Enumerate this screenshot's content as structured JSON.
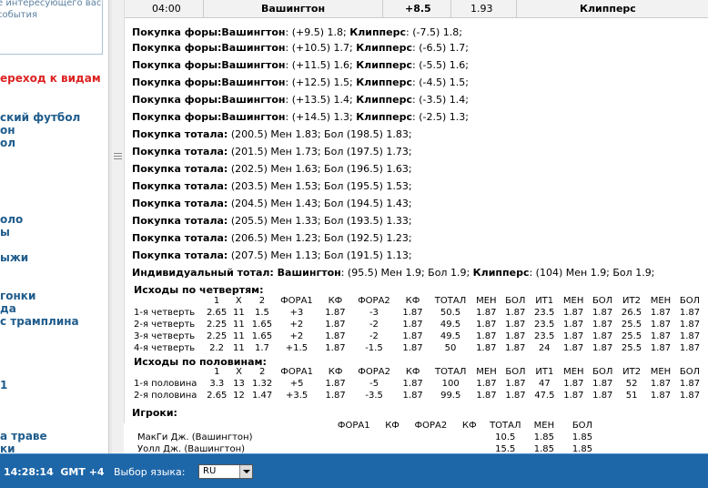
{
  "sidebar": {
    "box_lines": [
      "е интересующего вас",
      "события"
    ],
    "links": [
      {
        "label": "ереход к видам",
        "red": true
      },
      {
        "label": "ский футбол",
        "red": false
      },
      {
        "label": "он",
        "red": false
      },
      {
        "label": "ол",
        "red": false
      },
      {
        "label": "оло",
        "red": false
      },
      {
        "label": "ы",
        "red": false
      },
      {
        "label": "ыжи",
        "red": false
      },
      {
        "label": "гонки",
        "red": false
      },
      {
        "label": "да",
        "red": false
      },
      {
        "label": "с трамплина",
        "red": false
      },
      {
        "label": "1",
        "red": false
      },
      {
        "label": "а траве",
        "red": false
      },
      {
        "label": "ки",
        "red": false
      }
    ]
  },
  "match": {
    "time": "04:00",
    "team1": "Вашингтон",
    "handicap": "+8.5",
    "odds": "1.93",
    "team2": "Клипперс"
  },
  "lines": [
    {
      "label": "Покупка форы:",
      "t1": "Вашингтон",
      "t1v": ": (+9.5) 1.8; ",
      "t2": "Клипперс",
      "t2v": ": (-7.5) 1.8;"
    },
    {
      "label": "Покупка форы:",
      "t1": "Вашингтон",
      "t1v": ": (+10.5) 1.7; ",
      "t2": "Клипперс",
      "t2v": ": (-6.5) 1.7;"
    },
    {
      "label": "Покупка форы:",
      "t1": "Вашингтон",
      "t1v": ": (+11.5) 1.6; ",
      "t2": "Клипперс",
      "t2v": ": (-5.5) 1.6;"
    },
    {
      "label": "Покупка форы:",
      "t1": "Вашингтон",
      "t1v": ": (+12.5) 1.5; ",
      "t2": "Клипперс",
      "t2v": ": (-4.5) 1.5;"
    },
    {
      "label": "Покупка форы:",
      "t1": "Вашингтон",
      "t1v": ": (+13.5) 1.4; ",
      "t2": "Клипперс",
      "t2v": ": (-3.5) 1.4;"
    },
    {
      "label": "Покупка форы:",
      "t1": "Вашингтон",
      "t1v": ": (+14.5) 1.3; ",
      "t2": "Клипперс",
      "t2v": ": (-2.5) 1.3;"
    },
    {
      "label": "Покупка тотала:",
      "t1": "",
      "t1v": " (200.5) Мен 1.83; Бол (198.5) 1.83;",
      "t2": "",
      "t2v": ""
    },
    {
      "label": "Покупка тотала:",
      "t1": "",
      "t1v": " (201.5) Мен 1.73; Бол (197.5) 1.73;",
      "t2": "",
      "t2v": ""
    },
    {
      "label": "Покупка тотала:",
      "t1": "",
      "t1v": " (202.5) Мен 1.63; Бол (196.5) 1.63;",
      "t2": "",
      "t2v": ""
    },
    {
      "label": "Покупка тотала:",
      "t1": "",
      "t1v": " (203.5) Мен 1.53; Бол (195.5) 1.53;",
      "t2": "",
      "t2v": ""
    },
    {
      "label": "Покупка тотала:",
      "t1": "",
      "t1v": " (204.5) Мен 1.43; Бол (194.5) 1.43;",
      "t2": "",
      "t2v": ""
    },
    {
      "label": "Покупка тотала:",
      "t1": "",
      "t1v": " (205.5) Мен 1.33; Бол (193.5) 1.33;",
      "t2": "",
      "t2v": ""
    },
    {
      "label": "Покупка тотала:",
      "t1": "",
      "t1v": " (206.5) Мен 1.23; Бол (192.5) 1.23;",
      "t2": "",
      "t2v": ""
    },
    {
      "label": "Покупка тотала:",
      "t1": "",
      "t1v": " (207.5) Мен 1.13; Бол (191.5) 1.13;",
      "t2": "",
      "t2v": ""
    },
    {
      "label": "Индивидуальный тотал:",
      "t1": " Вашингтон",
      "t1v": ": (95.5) Мен 1.9; Бол 1.9; ",
      "t2": "Клипперс",
      "t2v": ": (104) Мен 1.9; Бол 1.9;"
    }
  ],
  "quarters": {
    "title": "Исходы по четвертям:",
    "header": [
      "",
      "1",
      "X",
      "2",
      "ФОРА1",
      "КФ",
      "ФОРА2",
      "КФ",
      "ТОТАЛ",
      "МЕН",
      "БОЛ",
      "ИТ1",
      "МЕН",
      "БОЛ",
      "ИТ2",
      "МЕН",
      "БОЛ"
    ],
    "rows": [
      [
        "1-я четверть",
        "2.65",
        "11",
        "1.5",
        "+3",
        "1.87",
        "-3",
        "1.87",
        "50.5",
        "1.87",
        "1.87",
        "23.5",
        "1.87",
        "1.87",
        "26.5",
        "1.87",
        "1.87"
      ],
      [
        "2-я четверть",
        "2.25",
        "11",
        "1.65",
        "+2",
        "1.87",
        "-2",
        "1.87",
        "49.5",
        "1.87",
        "1.87",
        "23.5",
        "1.87",
        "1.87",
        "25.5",
        "1.87",
        "1.87"
      ],
      [
        "3-я четверть",
        "2.25",
        "11",
        "1.65",
        "+2",
        "1.87",
        "-2",
        "1.87",
        "49.5",
        "1.87",
        "1.87",
        "23.5",
        "1.87",
        "1.87",
        "25.5",
        "1.87",
        "1.87"
      ],
      [
        "4-я четверть",
        "2.2",
        "11",
        "1.7",
        "+1.5",
        "1.87",
        "-1.5",
        "1.87",
        "50",
        "1.87",
        "1.87",
        "24",
        "1.87",
        "1.87",
        "25.5",
        "1.87",
        "1.87"
      ]
    ]
  },
  "halves": {
    "title": "Исходы по половинам:",
    "header": [
      "",
      "1",
      "X",
      "2",
      "ФОРА1",
      "КФ",
      "ФОРА2",
      "КФ",
      "ТОТАЛ",
      "МЕН",
      "БОЛ",
      "ИТ1",
      "МЕН",
      "БОЛ",
      "ИТ2",
      "МЕН",
      "БОЛ"
    ],
    "rows": [
      [
        "1-я половина",
        "3.3",
        "13",
        "1.32",
        "+5",
        "1.87",
        "-5",
        "1.87",
        "100",
        "1.87",
        "1.87",
        "47",
        "1.87",
        "1.87",
        "52",
        "1.87",
        "1.87"
      ],
      [
        "2-я половина",
        "2.65",
        "12",
        "1.47",
        "+3.5",
        "1.87",
        "-3.5",
        "1.87",
        "99.5",
        "1.87",
        "1.87",
        "47.5",
        "1.87",
        "1.87",
        "51",
        "1.87",
        "1.87"
      ]
    ]
  },
  "players": {
    "title": "Игроки:",
    "header": [
      "",
      "ФОРА1",
      "КФ",
      "ФОРА2",
      "КФ",
      "ТОТАЛ",
      "МЕН",
      "БОЛ"
    ],
    "rows": [
      [
        "МакГи Дж. (Вашингтон)",
        "",
        "",
        "",
        "",
        "10.5",
        "1.85",
        "1.85"
      ],
      [
        "Уолл Дж. (Вашингтон)",
        "",
        "",
        "",
        "",
        "15.5",
        "1.85",
        "1.85"
      ]
    ]
  },
  "footer": {
    "time": "14:28:14",
    "tz": "GMT +4",
    "lang_label": "Выбор языка:",
    "lang_value": "RU"
  },
  "colors": {
    "accent": "#1d66a8",
    "link": "#1f5c8c",
    "link_red": "#dd2222"
  }
}
